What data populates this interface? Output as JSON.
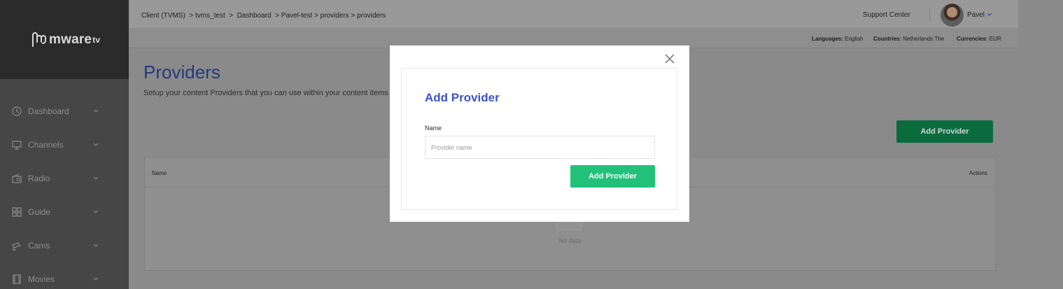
{
  "brand": {
    "logo_text": "mware",
    "logo_sup": "tv"
  },
  "sidebar": {
    "items": [
      {
        "label": "Dashboard",
        "icon": "dashboard-icon"
      },
      {
        "label": "Channels",
        "icon": "monitor-icon"
      },
      {
        "label": "Radio",
        "icon": "radio-icon"
      },
      {
        "label": "Guide",
        "icon": "guide-icon"
      },
      {
        "label": "Cams",
        "icon": "cams-icon"
      },
      {
        "label": "Movies",
        "icon": "movies-icon"
      }
    ]
  },
  "topbar": {
    "breadcrumb": "Client (TVMS)  > tvms_test  >  Dashboard  > Pavel-test > providers > providers",
    "support": "Support Center",
    "user": "Pavel"
  },
  "subbar": {
    "languages_label": "Languages:",
    "languages_value": "English",
    "countries_label": "Countries:",
    "countries_value": "Netherlands The",
    "currencies_label": "Currencies:",
    "currencies_value": "EUR"
  },
  "page": {
    "title": "Providers",
    "description": "Setup your content Providers that you can use within your content items",
    "add_button": "Add Provider"
  },
  "table": {
    "columns": [
      "Name",
      "Actions"
    ],
    "empty_text": "No data"
  },
  "modal": {
    "title": "Add Provider",
    "name_label": "Name",
    "name_value": "",
    "name_placeholder": "Provider name",
    "submit_label": "Add Provider"
  },
  "colors": {
    "modal_title": "#3d53c8",
    "modal_button": "#21c17a",
    "page_button": "#0b6b3f",
    "page_title": "#233a7a"
  }
}
